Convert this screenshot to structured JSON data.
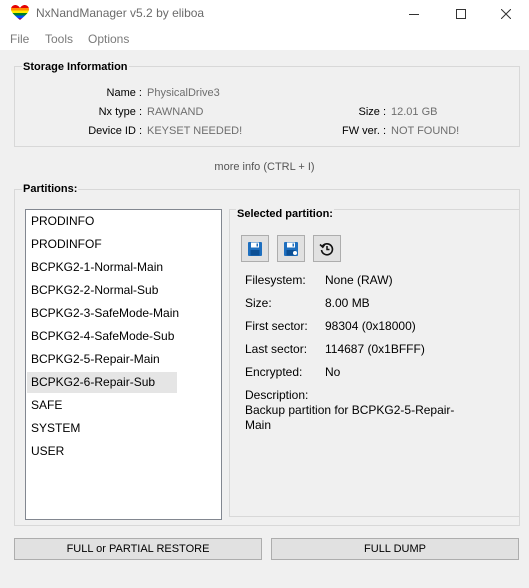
{
  "window": {
    "title": "NxNandManager v5.2 by eliboa"
  },
  "menu": {
    "items": [
      "File",
      "Tools",
      "Options"
    ]
  },
  "storage": {
    "title": "Storage Information",
    "name_label": "Name :",
    "name_value": "PhysicalDrive3",
    "nxtype_label": "Nx type :",
    "nxtype_value": "RAWNAND",
    "deviceid_label": "Device ID :",
    "deviceid_value": "KEYSET NEEDED!",
    "size_label": "Size :",
    "size_value": "12.01 GB",
    "fwver_label": "FW ver. :",
    "fwver_value": "NOT FOUND!"
  },
  "more_info": "more info (CTRL + I)",
  "partitions": {
    "title": "Partitions:",
    "items": [
      "PRODINFO",
      "PRODINFOF",
      "BCPKG2-1-Normal-Main",
      "BCPKG2-2-Normal-Sub",
      "BCPKG2-3-SafeMode-Main",
      "BCPKG2-4-SafeMode-Sub",
      "BCPKG2-5-Repair-Main",
      "BCPKG2-6-Repair-Sub",
      "SAFE",
      "SYSTEM",
      "USER"
    ],
    "selected": "BCPKG2-6-Repair-Sub"
  },
  "selected_partition": {
    "title": "Selected partition:",
    "filesystem_label": "Filesystem:",
    "filesystem_value": "None (RAW)",
    "size_label": "Size:",
    "size_value": "8.00 MB",
    "first_sector_label": "First sector:",
    "first_sector_value": "98304 (0x18000)",
    "last_sector_label": "Last sector:",
    "last_sector_value": "114687 (0x1BFFF)",
    "encrypted_label": "Encrypted:",
    "encrypted_value": "No",
    "description_label": "Description:",
    "description_line1": "Backup partition for BCPKG2-5-Repair-",
    "description_line2": "Main",
    "tools": [
      "dump-icon",
      "save-as-icon",
      "restore-icon"
    ]
  },
  "buttons": {
    "restore": "FULL or PARTIAL RESTORE",
    "dump": "FULL DUMP"
  },
  "colors": {
    "accent_blue": "#1e6fbf",
    "list_selection": "#e5e5e5"
  }
}
